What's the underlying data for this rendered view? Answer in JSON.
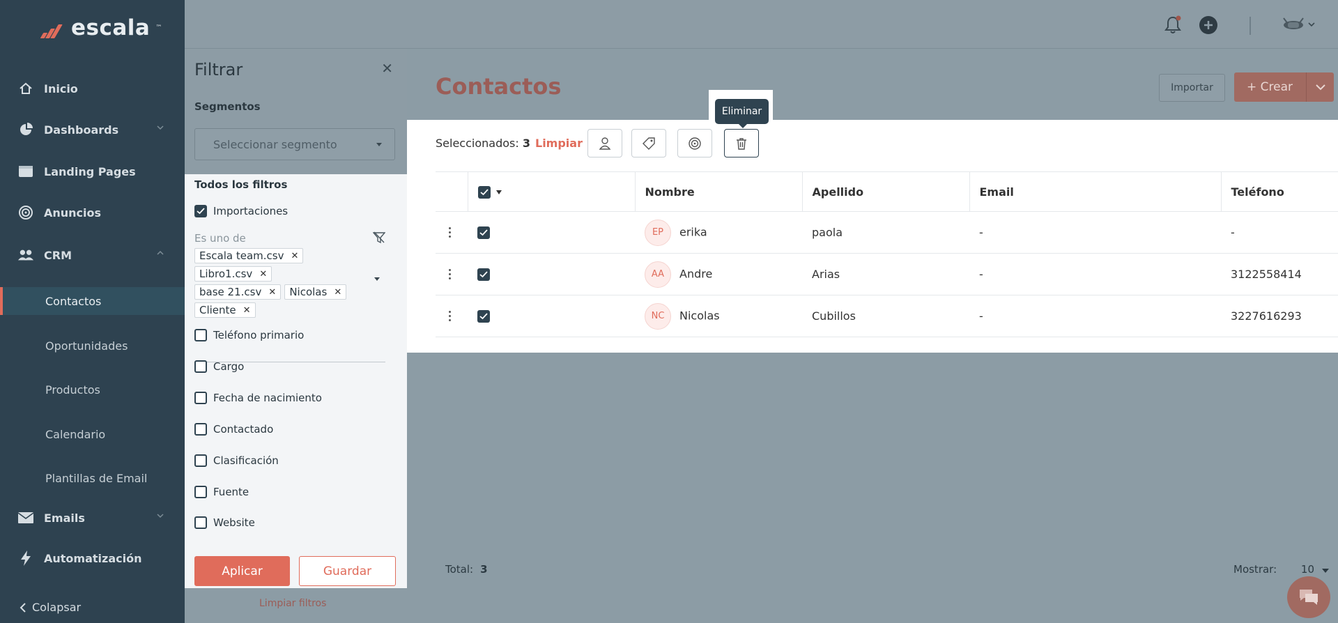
{
  "app": {
    "logo_text": "escala",
    "logo_tm": "™"
  },
  "sidebar": {
    "items": [
      {
        "label": "Inicio",
        "icon": "home-icon"
      },
      {
        "label": "Dashboards",
        "icon": "pie-chart-icon"
      },
      {
        "label": "Landing Pages",
        "icon": "browser-icon"
      },
      {
        "label": "Anuncios",
        "icon": "target-icon"
      },
      {
        "label": "CRM",
        "icon": "users-icon"
      },
      {
        "label": "Emails",
        "icon": "mail-icon"
      },
      {
        "label": "Automatización",
        "icon": "lightning-icon"
      }
    ],
    "crm_sub": [
      {
        "label": "Contactos",
        "active": true
      },
      {
        "label": "Oportunidades"
      },
      {
        "label": "Productos"
      },
      {
        "label": "Calendario"
      },
      {
        "label": "Plantillas de Email"
      }
    ],
    "collapse_label": "Colapsar"
  },
  "header": {
    "page_title": "Contactos",
    "import_label": "Importar",
    "create_label": "+ Crear"
  },
  "toolbar": {
    "selected_label": "Seleccionados:",
    "selected_count": "3",
    "clear_label": "Limpiar",
    "tooltip": "Eliminar"
  },
  "table": {
    "columns": [
      "Nombre",
      "Apellido",
      "Email",
      "Teléfono"
    ],
    "rows": [
      {
        "initials": "EP",
        "nombre": "erika",
        "apellido": "paola",
        "email": "-",
        "telefono": "-"
      },
      {
        "initials": "AA",
        "nombre": "Andre",
        "apellido": "Arias",
        "email": "-",
        "telefono": "3122558414"
      },
      {
        "initials": "NC",
        "nombre": "Nicolas",
        "apellido": "Cubillos",
        "email": "-",
        "telefono": "3227616293"
      }
    ]
  },
  "footer": {
    "total_label": "Total:",
    "total_value": "3",
    "show_label": "Mostrar:",
    "show_value": "10"
  },
  "filter": {
    "title": "Filtrar",
    "segments_label": "Segmentos",
    "segment_placeholder": "Seleccionar segmento",
    "all_filters_label": "Todos los filtros",
    "importaciones_label": "Importaciones",
    "es_uno_de": "Es uno de",
    "tags": [
      "Escala team.csv",
      "Libro1.csv",
      "base 21.csv",
      "Nicolas",
      "Cliente"
    ],
    "checks": [
      "Teléfono primario",
      "Cargo",
      "Fecha de nacimiento",
      "Contactado",
      "Clasificación",
      "Fuente",
      "Website"
    ],
    "apply_label": "Aplicar",
    "save_label": "Guardar",
    "clear_filters_label": "Limpiar filtros"
  },
  "colors": {
    "accent": "#e06c5b",
    "sidebar": "#2e4250",
    "overlay": "#8c9ca5"
  }
}
